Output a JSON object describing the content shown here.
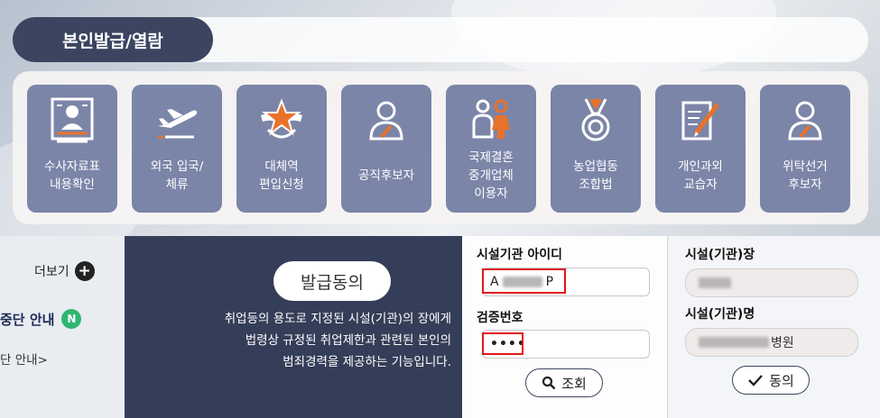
{
  "header": {
    "title": "본인발급/열람"
  },
  "menu": [
    {
      "label": "수사자료표\n내용확인",
      "icon": "document-person-icon"
    },
    {
      "label": "외국 입국/\n체류",
      "icon": "airplane-icon"
    },
    {
      "label": "대체역\n편입신청",
      "icon": "military-emblem-icon"
    },
    {
      "label": "공직후보자",
      "icon": "person-icon"
    },
    {
      "label": "국제결혼\n중개업체\n이용자",
      "icon": "couple-icon"
    },
    {
      "label": "농업협동\n조합법",
      "icon": "medal-icon"
    },
    {
      "label": "개인과외\n교습자",
      "icon": "notepad-pen-icon"
    },
    {
      "label": "위탁선거\n후보자",
      "icon": "person-icon"
    }
  ],
  "sidebar": {
    "more_label": "더보기",
    "notice_title": "중단 안내",
    "notice_badge": "N",
    "notice_sub": "단 안내>"
  },
  "consent": {
    "title": "발급동의",
    "description": "취업등의 용도로 지정된 시설(기관)의 장에게\n법령상 규정된 취업제한과 관련된 본인의\n범죄경력을 제공하는 기능입니다."
  },
  "form": {
    "id_label": "시설기관 아이디",
    "id_value_prefix": "A",
    "id_value_suffix": "P",
    "code_label": "검증번호",
    "code_value": "••••",
    "lookup_label": "조회"
  },
  "facility": {
    "head_label": "시설(기관)장",
    "name_label": "시설(기관)명",
    "name_suffix": "병원",
    "agree_label": "동의"
  },
  "colors": {
    "primary_dark": "#3b4560",
    "tile": "#7b85a8",
    "accent_orange": "#e8722a",
    "highlight_red": "#e01818",
    "badge_green": "#2eb672"
  }
}
